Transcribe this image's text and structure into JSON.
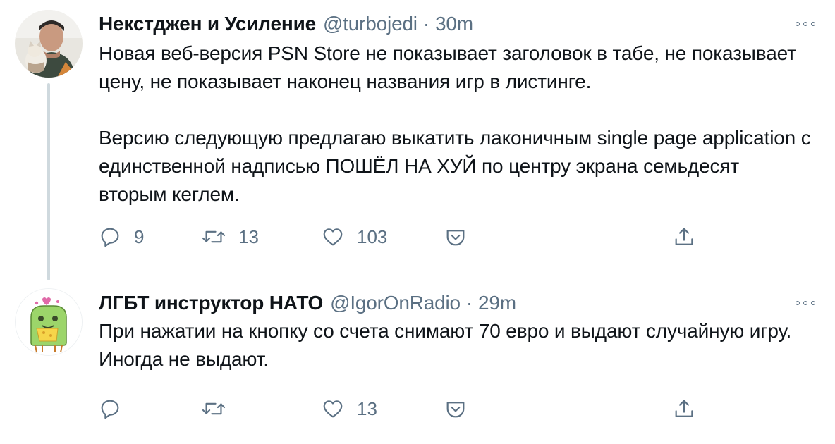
{
  "tweets": [
    {
      "display_name": "Некстджен и Усиление",
      "handle": "@turbojedi",
      "separator": "·",
      "time": "30m",
      "paragraphs": [
        "Новая веб-версия PSN Store не показывает заголовок в табе, не показывает цену, не показывает наконец названия игр в листинге.",
        "Версию следующую предлагаю выкатить лаконичным single page application с единственной надписью ПОШЁЛ НА ХУЙ по центру экрана семьдесят вторым кеглем."
      ],
      "replies": "9",
      "retweets": "13",
      "likes": "103"
    },
    {
      "display_name": "ЛГБТ инструктор НАТО",
      "handle": "@IgorOnRadio",
      "separator": "·",
      "time": "29m",
      "paragraphs": [
        "При нажатии на кнопку со счета снимают 70 евро и выдают случайную игру. Иногда не выдают."
      ],
      "replies": "",
      "retweets": "",
      "likes": "13"
    }
  ],
  "icons": {
    "reply": "reply-icon",
    "retweet": "retweet-icon",
    "like": "heart-icon",
    "share": "share-icon",
    "upload": "upload-icon",
    "more": "more-icon"
  },
  "colors": {
    "text": "#0f1419",
    "secondary": "#5b7083",
    "thread_line": "#cfd9de"
  }
}
